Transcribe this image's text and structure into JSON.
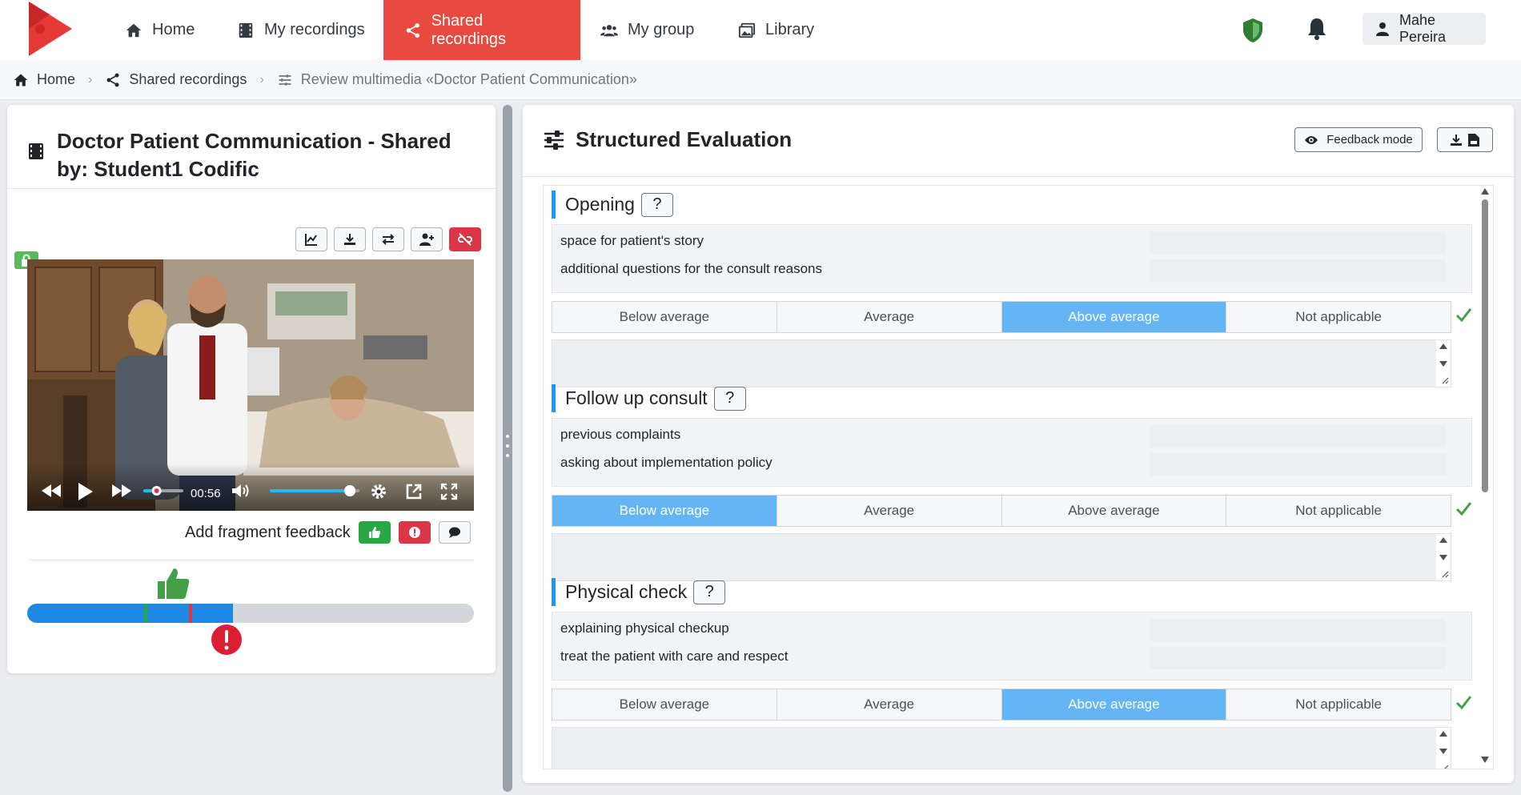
{
  "nav": {
    "items": [
      {
        "label": "Home",
        "icon": "home-icon"
      },
      {
        "label": "My recordings",
        "icon": "film-icon"
      },
      {
        "label": "Shared recordings",
        "icon": "share-icon",
        "active": true
      },
      {
        "label": "My group",
        "icon": "users-icon"
      },
      {
        "label": "Library",
        "icon": "images-icon"
      }
    ],
    "user_name": "Mahe Pereira",
    "accent_color": "#e84a3f"
  },
  "breadcrumb": {
    "home": "Home",
    "shared": "Shared recordings",
    "current": "Review multimedia «Doctor Patient Communication»"
  },
  "left": {
    "title": "Doctor Patient Communication - Shared by: Student1 Codific",
    "video": {
      "time": "00:56",
      "progress": 0.28,
      "volume": 0.95
    },
    "feedback_label": "Add fragment feedback",
    "timeline": {
      "progress": 0.46,
      "markers": [
        {
          "type": "positive",
          "position": 0.265,
          "color": "#28a745"
        },
        {
          "type": "negative",
          "position": 0.365,
          "color": "#dc3545"
        }
      ]
    }
  },
  "right": {
    "title": "Structured Evaluation",
    "feedback_mode_label": "Feedback mode",
    "rating_options": [
      "Below average",
      "Average",
      "Above average",
      "Not applicable"
    ],
    "sections": [
      {
        "title": "Opening",
        "help": "?",
        "items": [
          "space for patient's story",
          "additional questions for the consult reasons"
        ],
        "selected": 2
      },
      {
        "title": "Follow up consult",
        "help": "?",
        "items": [
          "previous complaints",
          "asking about implementation policy"
        ],
        "selected": 0
      },
      {
        "title": "Physical check",
        "help": "?",
        "items": [
          "explaining physical checkup",
          "treat the patient with care and respect"
        ],
        "selected": 2
      }
    ]
  }
}
